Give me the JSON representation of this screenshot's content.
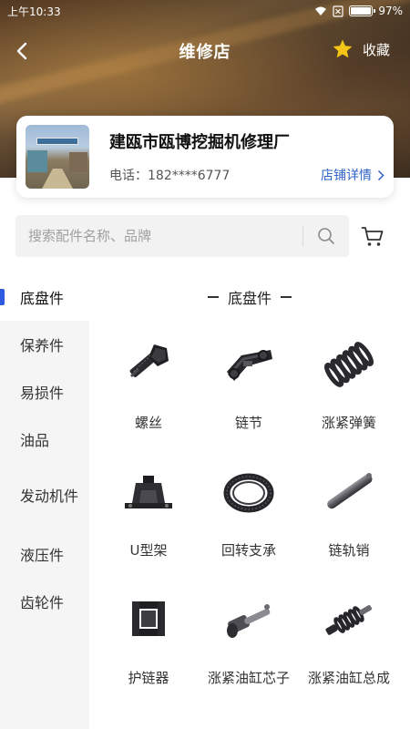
{
  "status_bar": {
    "time": "上午10:33",
    "battery": "97%",
    "battery_level": 0.97
  },
  "header": {
    "title": "维修店",
    "favorite_label": "收藏"
  },
  "shop": {
    "name": "建瓯市瓯博挖掘机修理厂",
    "phone": "电话：182****6777",
    "detail_link": "店铺详情"
  },
  "search": {
    "placeholder": "搜索配件名称、品牌"
  },
  "sidebar": {
    "items": [
      {
        "label": "底盘件",
        "active": true
      },
      {
        "label": "保养件"
      },
      {
        "label": "易损件"
      },
      {
        "label": "油品"
      },
      {
        "label": "发动机件"
      },
      {
        "label": "液压件"
      },
      {
        "label": "齿轮件"
      }
    ]
  },
  "content": {
    "section_title": "底盘件",
    "products": [
      {
        "label": "螺丝",
        "icon": "bolt-icon"
      },
      {
        "label": "链节",
        "icon": "track-link-icon"
      },
      {
        "label": "涨紧弹簧",
        "icon": "spring-icon"
      },
      {
        "label": "U型架",
        "icon": "u-bracket-icon"
      },
      {
        "label": "回转支承",
        "icon": "slewing-ring-icon"
      },
      {
        "label": "链轨销",
        "icon": "track-pin-icon"
      },
      {
        "label": "护链器",
        "icon": "chain-guard-icon"
      },
      {
        "label": "涨紧油缸芯子",
        "icon": "cylinder-core-icon"
      },
      {
        "label": "涨紧油缸总成",
        "icon": "cylinder-assembly-icon"
      }
    ]
  },
  "colors": {
    "accent": "#2f5be0",
    "link": "#2f62c9",
    "star": "#f5c518"
  }
}
